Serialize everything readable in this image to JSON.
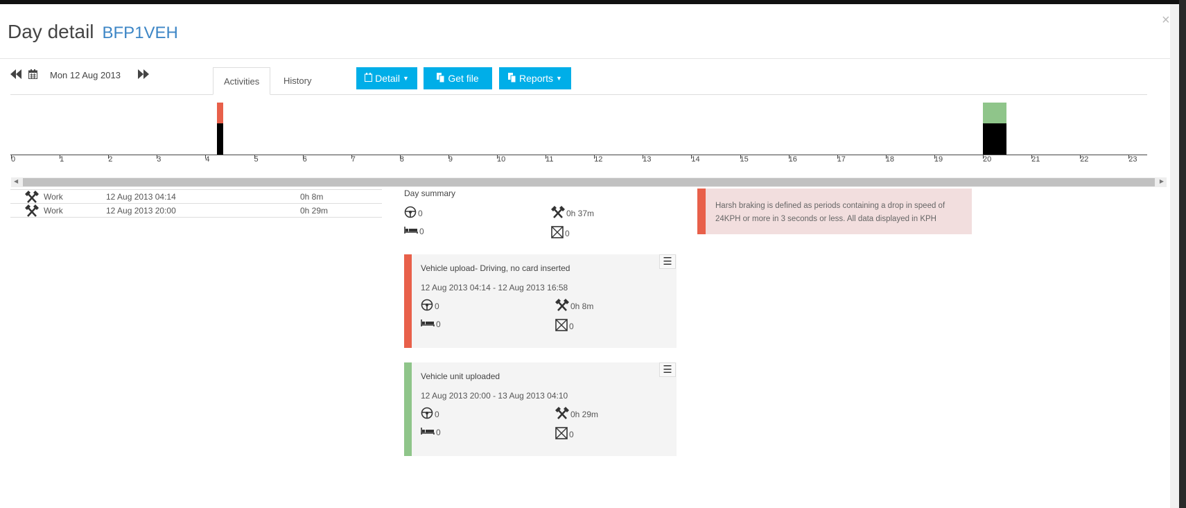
{
  "header": {
    "title": "Day detail",
    "vehicle": "BFP1VEH",
    "close": "×"
  },
  "nav": {
    "date": "Mon 12 Aug 2013",
    "prev_icon": "fast-backward-icon",
    "calendar_icon": "calendar-icon",
    "next_icon": "fast-forward-icon"
  },
  "tabs": [
    {
      "label": "Activities",
      "active": true
    },
    {
      "label": "History",
      "active": false
    }
  ],
  "buttons": {
    "detail": "Detail",
    "get_file": "Get file",
    "reports": "Reports"
  },
  "colors": {
    "accent": "#00aee8",
    "red": "#e8604a",
    "green": "#8fc58a",
    "work": "#000000",
    "alert_bg": "#f2dede"
  },
  "timeline": {
    "hours": [
      "0",
      "1",
      "2",
      "3",
      "4",
      "5",
      "6",
      "7",
      "8",
      "9",
      "10",
      "11",
      "12",
      "13",
      "14",
      "15",
      "16",
      "17",
      "18",
      "19",
      "20",
      "21",
      "22",
      "23"
    ],
    "segments": [
      {
        "start_hour": 4.233,
        "duration_min": 8,
        "status_color": "#e8604a",
        "activity": "Work"
      },
      {
        "start_hour": 20.0,
        "duration_min": 29,
        "status_color": "#8fc58a",
        "activity": "Work"
      }
    ]
  },
  "activities": [
    {
      "icon": "work-hammers-icon",
      "type": "Work",
      "start": "12 Aug 2013 04:14",
      "duration": "0h 8m"
    },
    {
      "icon": "work-hammers-icon",
      "type": "Work",
      "start": "12 Aug 2013 20:00",
      "duration": "0h 29m"
    }
  ],
  "summary": {
    "title": "Day summary",
    "driving": "0",
    "work": "0h 37m",
    "rest": "0",
    "unknown": "0"
  },
  "cards": [
    {
      "title": "Vehicle upload- Driving, no card inserted",
      "range": "12 Aug 2013 04:14 - 12 Aug 2013 16:58",
      "driving": "0",
      "work": "0h 8m",
      "rest": "0",
      "unknown": "0",
      "color": "#e8604a",
      "menu": "☰"
    },
    {
      "title": "Vehicle unit uploaded",
      "range": "12 Aug 2013 20:00 - 13 Aug 2013 04:10",
      "driving": "0",
      "work": "0h 29m",
      "rest": "0",
      "unknown": "0",
      "color": "#8fc58a",
      "menu": "☰"
    }
  ],
  "alert": {
    "text": "Harsh braking is defined as periods containing a drop in speed of 24KPH or more in 3 seconds or less. All data displayed in KPH"
  }
}
